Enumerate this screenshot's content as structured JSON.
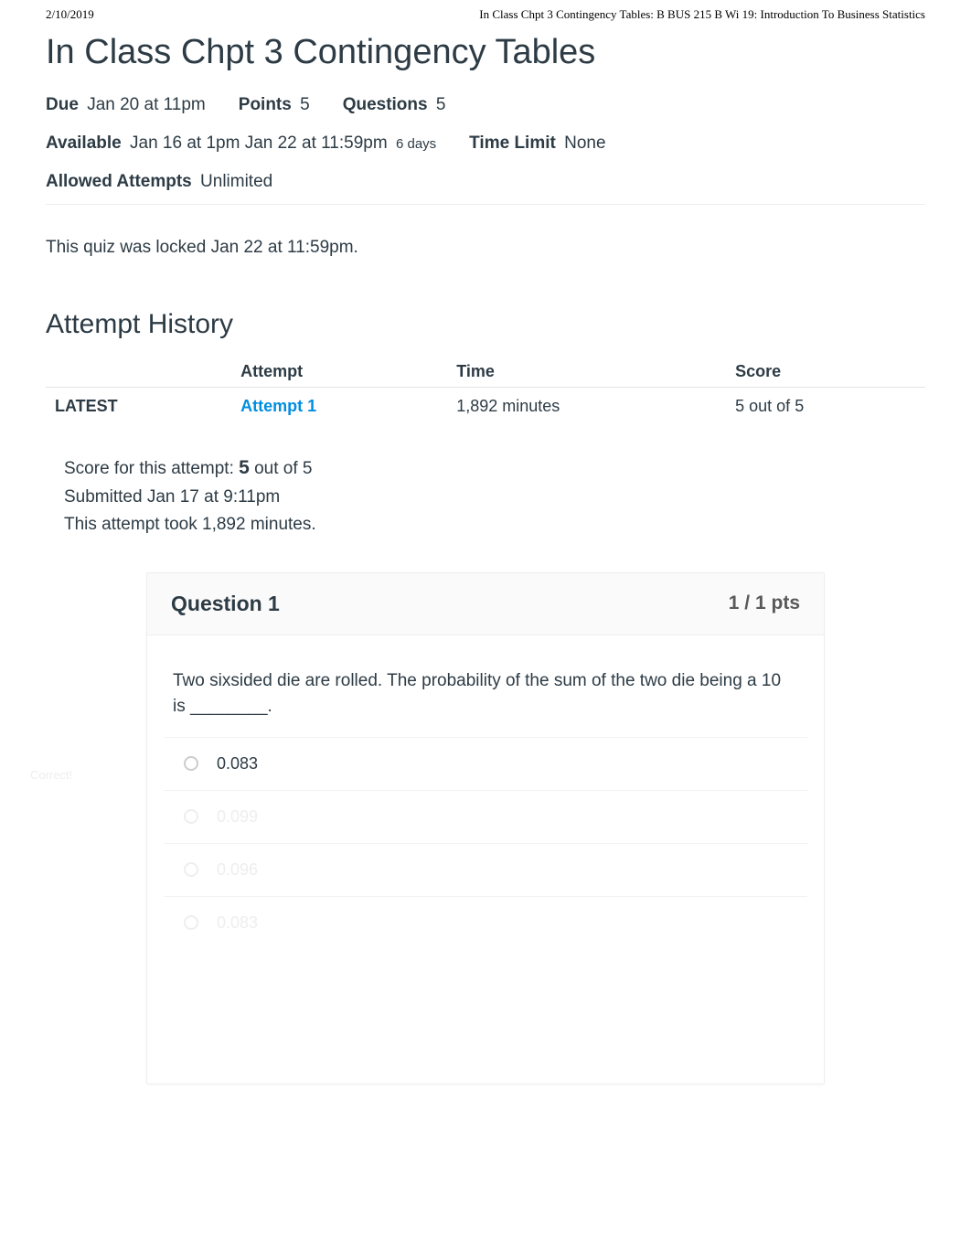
{
  "header": {
    "date": "2/10/2019",
    "source_title": "In Class Chpt 3 Contingency Tables: B BUS 215 B Wi 19: Introduction To Business Statistics"
  },
  "page_title": "In Class Chpt 3 Contingency Tables",
  "meta": {
    "due_label": "Due",
    "due_value": "Jan 20 at 11pm",
    "points_label": "Points",
    "points_value": "5",
    "questions_label": "Questions",
    "questions_value": "5",
    "available_label": "Available",
    "available_value": "Jan 16 at 1pm  Jan 22 at 11:59pm",
    "available_days": "6 days",
    "time_limit_label": "Time Limit",
    "time_limit_value": "None",
    "allowed_attempts_label": "Allowed Attempts",
    "allowed_attempts_value": "Unlimited"
  },
  "locked_msg": "This quiz was locked Jan 22 at 11:59pm.",
  "history": {
    "heading": "Attempt History",
    "columns": {
      "attempt": "Attempt",
      "time": "Time",
      "score": "Score"
    },
    "rows": [
      {
        "tag": "LATEST",
        "attempt_label": "Attempt 1",
        "time": "1,892 minutes",
        "score": "5 out of 5"
      }
    ]
  },
  "score_block": {
    "line1_pre": "Score for this attempt: ",
    "line1_score": "5",
    "line1_post": " out of 5",
    "line2": "Submitted Jan 17 at 9:11pm",
    "line3": "This attempt took 1,892 minutes."
  },
  "question1": {
    "title": "Question 1",
    "pts": "1 / 1 pts",
    "text": "Two sixsided die are rolled. The probability of the sum of the two die being a 10 is ________.",
    "side_tag": "Correct!",
    "answers": [
      "0.083",
      "0.099",
      "0.096",
      "0.083"
    ]
  }
}
